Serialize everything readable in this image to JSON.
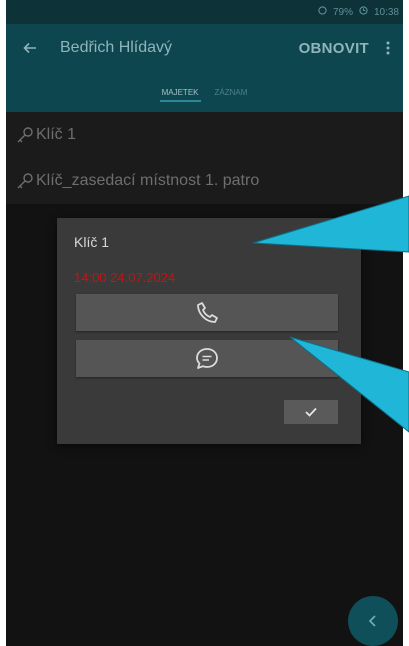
{
  "status_bar": {
    "battery": "79%",
    "time": "10:38"
  },
  "app_bar": {
    "title": "Bedřich Hlídavý",
    "refresh_label": "OBNOVIT"
  },
  "tabs": [
    {
      "label": "MAJETEK",
      "active": true
    },
    {
      "label": "ZÁZNAM",
      "active": false
    }
  ],
  "list": [
    {
      "label": "Klíč 1"
    },
    {
      "label": "Klíč_zasedací místnost 1. patro"
    }
  ],
  "dialog": {
    "title": "Klíč 1",
    "date": "14:00 24.07.2024",
    "call_icon": "phone-icon",
    "message_icon": "chat-bubble-icon",
    "confirm_icon": "check-icon"
  },
  "fab": {
    "icon": "chevron-left-icon"
  },
  "colors": {
    "accent": "#0e4650",
    "date_red": "#c71212",
    "callout": "#1fb6d8"
  }
}
